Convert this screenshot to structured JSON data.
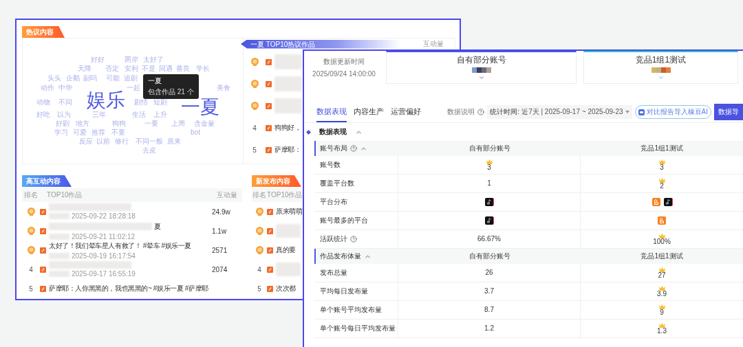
{
  "hot_section": {
    "tag": "热议内容",
    "word_cloud": [
      {
        "text": "好好",
        "kind": "minor"
      },
      {
        "text": "两岸",
        "kind": "minor"
      },
      {
        "text": "太好了",
        "kind": "minor"
      },
      {
        "text": "天降",
        "kind": "minor"
      },
      {
        "text": "否定",
        "kind": "minor"
      },
      {
        "text": "安利",
        "kind": "minor"
      },
      {
        "text": "不是",
        "kind": "minor"
      },
      {
        "text": "同遇",
        "kind": "minor"
      },
      {
        "text": "善良",
        "kind": "minor"
      },
      {
        "text": "学长",
        "kind": "minor"
      },
      {
        "text": "头头",
        "kind": "minor"
      },
      {
        "text": "企鹅",
        "kind": "minor"
      },
      {
        "text": "副吗",
        "kind": "minor"
      },
      {
        "text": "可能",
        "kind": "minor"
      },
      {
        "text": "追剧",
        "kind": "minor"
      },
      {
        "text": "动作",
        "kind": "minor"
      },
      {
        "text": "中华",
        "kind": "minor"
      },
      {
        "text": "一起",
        "kind": "minor"
      },
      {
        "text": "美食",
        "kind": "minor"
      },
      {
        "text": "动物",
        "kind": "minor"
      },
      {
        "text": "不同",
        "kind": "minor"
      },
      {
        "text": "娱乐",
        "kind": "major"
      },
      {
        "text": "剧情",
        "kind": "minor"
      },
      {
        "text": "短剧",
        "kind": "minor"
      },
      {
        "text": "好吃",
        "kind": "minor"
      },
      {
        "text": "以为",
        "kind": "minor"
      },
      {
        "text": "三年",
        "kind": "minor"
      },
      {
        "text": "生活",
        "kind": "minor"
      },
      {
        "text": "上升",
        "kind": "minor"
      },
      {
        "text": "一夏",
        "kind": "major"
      },
      {
        "text": "好剧",
        "kind": "minor"
      },
      {
        "text": "地方",
        "kind": "minor"
      },
      {
        "text": "狗狗",
        "kind": "minor"
      },
      {
        "text": "一要",
        "kind": "minor"
      },
      {
        "text": "上周",
        "kind": "minor"
      },
      {
        "text": "含金量",
        "kind": "minor"
      },
      {
        "text": "学习",
        "kind": "minor"
      },
      {
        "text": "可爱",
        "kind": "minor"
      },
      {
        "text": "推荐",
        "kind": "minor"
      },
      {
        "text": "不要",
        "kind": "minor"
      },
      {
        "text": "bot",
        "kind": "minor"
      },
      {
        "text": "反应",
        "kind": "minor"
      },
      {
        "text": "以前",
        "kind": "minor"
      },
      {
        "text": "修行",
        "kind": "minor"
      },
      {
        "text": "不同一般",
        "kind": "minor"
      },
      {
        "text": "原来",
        "kind": "minor"
      },
      {
        "text": "去皮",
        "kind": "minor"
      }
    ],
    "tooltip": {
      "title": "一夏",
      "detail": "包含作品 21 个"
    },
    "top_list": {
      "title": "一夏 TOP10热议作品",
      "value_header": "互动量",
      "rows": [
        {
          "kind": "medal"
        },
        {
          "kind": "medal"
        },
        {
          "kind": "medal"
        },
        {
          "kind": "number",
          "rank": "4",
          "title": "狗狗好，"
        },
        {
          "kind": "number",
          "rank": "5",
          "title": "萨摩耶："
        }
      ]
    }
  },
  "interaction_section": {
    "tag": "高互动内容",
    "columns": [
      "排名",
      "TOP10作品",
      "互动量"
    ],
    "rows": [
      {
        "kind": "medal",
        "date": "2025-09-22 18:28:18",
        "value": "24.9w"
      },
      {
        "kind": "medal",
        "title_tail": "夏",
        "date": "2025-09-21 11:02:12",
        "value": "1.1w"
      },
      {
        "kind": "medal",
        "title": "太好了！我们晕车星人有救了！ #晕车 #娱乐一夏",
        "date": "2025-09-19 16:17:54",
        "value": "2571"
      },
      {
        "kind": "number",
        "rank": "4",
        "date": "2025-09-17 16:55:19",
        "value": "2074"
      },
      {
        "kind": "number",
        "rank": "5",
        "title": "萨摩耶：人你黑黑的，我也黑黑的~ #娱乐一夏 #萨摩耶"
      }
    ]
  },
  "new_section": {
    "tag": "新发布内容",
    "columns": [
      "排名",
      "TOP10作品"
    ],
    "rows": [
      {
        "kind": "medal",
        "title": "原来萌萌"
      },
      {
        "kind": "medal"
      },
      {
        "kind": "medal",
        "title": "真的要"
      },
      {
        "kind": "number",
        "rank": "4"
      },
      {
        "kind": "number",
        "rank": "5",
        "title": "次次都"
      }
    ]
  },
  "compare_panel": {
    "update_label": "数据更新时间",
    "update_time": "2025/09/24 14:00:00",
    "groups": [
      {
        "name": "自有部分账号",
        "color": "#4a55e0"
      },
      {
        "name": "竞品1组1测试",
        "color": "#2ec9c0"
      }
    ],
    "tabs": [
      {
        "label": "数据表现",
        "selected": true
      },
      {
        "label": "内容生产",
        "selected": false
      },
      {
        "label": "运营偏好",
        "selected": false
      }
    ],
    "help_label": "数据说明",
    "date_filter": {
      "label": "统计时间:",
      "value": "近7天 | 2025-09-17 ~ 2025-09-23"
    },
    "ai_button": "对比报告导入橡豆AI",
    "export_button": "数据导",
    "section": {
      "title": "数据表现",
      "expanded": true
    },
    "tables": [
      {
        "title": "账号布局",
        "help": true,
        "expanded": true,
        "columns": [
          "自有部分账号",
          "竞品1组1测试"
        ],
        "rows": [
          {
            "label": "账号数",
            "help": false,
            "cells": [
              {
                "kind": "text",
                "text": "3",
                "crown": true
              },
              {
                "kind": "text",
                "text": "3",
                "crown": true
              }
            ]
          },
          {
            "label": "覆盖平台数",
            "help": false,
            "cells": [
              {
                "kind": "text",
                "text": "1",
                "crown": false
              },
              {
                "kind": "text",
                "text": "2",
                "crown": true
              }
            ]
          },
          {
            "label": "平台分布",
            "help": false,
            "cells": [
              {
                "kind": "platforms",
                "crown": false,
                "platforms": [
                  {
                    "kind": "note"
                  }
                ]
              },
              {
                "kind": "platforms",
                "crown": false,
                "platforms": [
                  {
                    "kind": "square"
                  },
                  {
                    "kind": "note"
                  }
                ]
              }
            ]
          },
          {
            "label": "账号最多的平台",
            "help": false,
            "cells": [
              {
                "kind": "platforms",
                "crown": false,
                "platforms": [
                  {
                    "kind": "note"
                  }
                ]
              },
              {
                "kind": "platforms",
                "crown": false,
                "platforms": [
                  {
                    "kind": "square"
                  }
                ]
              }
            ]
          },
          {
            "label": "活跃统计",
            "help": true,
            "cells": [
              {
                "kind": "text",
                "text": "66.67%",
                "crown": false
              },
              {
                "kind": "text",
                "text": "100%",
                "crown": true
              }
            ]
          }
        ]
      },
      {
        "title": "作品发布体量",
        "help": false,
        "expanded": true,
        "columns": [
          "自有部分账号",
          "竞品1组1测试"
        ],
        "rows": [
          {
            "label": "发布总量",
            "help": false,
            "cells": [
              {
                "kind": "text",
                "text": "26",
                "crown": false
              },
              {
                "kind": "text",
                "text": "27",
                "crown": true
              }
            ]
          },
          {
            "label": "平均每日发布量",
            "help": false,
            "cells": [
              {
                "kind": "text",
                "text": "3.7",
                "crown": false
              },
              {
                "kind": "text",
                "text": "3.9",
                "crown": true
              }
            ]
          },
          {
            "label": "单个账号平均发布量",
            "help": false,
            "cells": [
              {
                "kind": "text",
                "text": "8.7",
                "crown": false
              },
              {
                "kind": "text",
                "text": "9",
                "crown": true
              }
            ]
          },
          {
            "label": "单个账号每日平均发布量",
            "help": false,
            "cells": [
              {
                "kind": "text",
                "text": "1.2",
                "crown": false
              },
              {
                "kind": "text",
                "text": "1.3",
                "crown": true
              }
            ]
          }
        ]
      }
    ]
  }
}
